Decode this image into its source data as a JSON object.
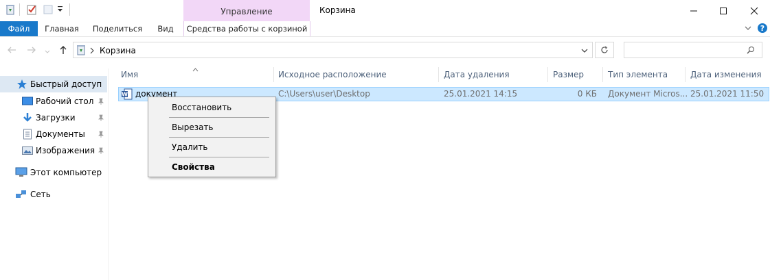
{
  "window": {
    "title": "Корзина",
    "context_tab_label": "Управление"
  },
  "ribbon": {
    "tabs": [
      {
        "label": "Файл"
      },
      {
        "label": "Главная"
      },
      {
        "label": "Поделиться"
      },
      {
        "label": "Вид"
      },
      {
        "label": "Средства работы с корзиной"
      }
    ]
  },
  "address": {
    "path": "Корзина"
  },
  "search": {
    "placeholder": ""
  },
  "sidebar": {
    "items": [
      {
        "label": "Быстрый доступ",
        "icon": "star-icon"
      },
      {
        "label": "Рабочий стол",
        "icon": "desktop-icon"
      },
      {
        "label": "Загрузки",
        "icon": "download-icon"
      },
      {
        "label": "Документы",
        "icon": "documents-icon"
      },
      {
        "label": "Изображения",
        "icon": "pictures-icon"
      },
      {
        "label": "Этот компьютер",
        "icon": "computer-icon"
      },
      {
        "label": "Сеть",
        "icon": "network-icon"
      }
    ]
  },
  "columns": [
    "Имя",
    "Исходное расположение",
    "Дата удаления",
    "Размер",
    "Тип элемента",
    "Дата изменения"
  ],
  "rows": [
    {
      "name": "документ",
      "location": "C:\\Users\\user\\Desktop",
      "deleted": "25.01.2021 14:15",
      "size": "0 КБ",
      "type": "Документ Micros...",
      "modified": "25.01.2021 11:50"
    }
  ],
  "context_menu": {
    "items": [
      {
        "label": "Восстановить"
      },
      {
        "label": "Вырезать"
      },
      {
        "label": "Удалить"
      },
      {
        "label": "Свойства"
      }
    ]
  },
  "colors": {
    "file_tab": "#1979ca",
    "context_tab": "#f2d7f7",
    "selection": "#cce8ff",
    "help": "#1979ca"
  }
}
